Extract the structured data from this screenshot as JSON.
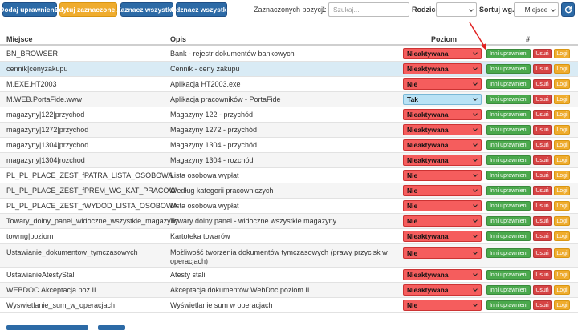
{
  "toolbar": {
    "add_label": "Dodaj uprawnienia",
    "bulk_label": "Edytuj zaznaczone",
    "select_all_label": "Zaznacz wszystkie",
    "deselect_all_label": "Odznacz wszystkie",
    "selected_count_label": "Zaznaczonych pozycji:",
    "selected_count_value": "1",
    "search_placeholder": "Szukaj...",
    "type_label": "Rodzic:",
    "type_value": "",
    "sort_label": "Sortuj wg.:",
    "sort_value": "Miejsce"
  },
  "table": {
    "columns": {
      "place": "Miejsce",
      "desc": "Opis",
      "level": "Poziom",
      "actions": "#"
    },
    "action_labels": {
      "other": "Inni uprawnieni",
      "delete": "Usuń",
      "logs": "Logi"
    },
    "rows": [
      {
        "place": "BN_BROWSER",
        "desc": "Bank - rejestr dokumentów bankowych",
        "level": "Nieaktywana",
        "level_color": "red"
      },
      {
        "place": "cennik|cenyzakupu",
        "desc": "Cennik - ceny zakupu",
        "level": "Nieaktywana",
        "level_color": "red"
      },
      {
        "place": "M.EXE.HT2003",
        "desc": "Aplikacja HT2003.exe",
        "level": "Nie",
        "level_color": "red"
      },
      {
        "place": "M.WEB.PortaFide.www",
        "desc": "Aplikacja pracowników - PortaFide",
        "level": "Tak",
        "level_color": "blue"
      },
      {
        "place": "magazyny|122|przychod",
        "desc": "Magazyny 122 - przychód",
        "level": "Nieaktywana",
        "level_color": "red"
      },
      {
        "place": "magazyny|1272|przychod",
        "desc": "Magazyny 1272 - przychód",
        "level": "Nieaktywana",
        "level_color": "red"
      },
      {
        "place": "magazyny|1304|przychod",
        "desc": "Magazyny 1304 - przychód",
        "level": "Nieaktywana",
        "level_color": "red"
      },
      {
        "place": "magazyny|1304|rozchod",
        "desc": "Magazyny 1304 - rozchód",
        "level": "Nieaktywana",
        "level_color": "red"
      },
      {
        "place": "PL_PL_PLACE_ZEST_fPATRA_LISTA_OSOBOWA",
        "desc": "Lista osobowa wypłat",
        "level": "Nie",
        "level_color": "red"
      },
      {
        "place": "PL_PL_PLACE_ZEST_fPREM_WG_KAT_PRACOW",
        "desc": "Według kategorii pracowniczych",
        "level": "Nie",
        "level_color": "red"
      },
      {
        "place": "PL_PL_PLACE_ZEST_fWYDOD_LISTA_OSOBOWA",
        "desc": "Lista osobowa wypłat",
        "level": "Nie",
        "level_color": "red"
      },
      {
        "place": "Towary_dolny_panel_widoczne_wszystkie_magazyny",
        "desc": "Towary dolny panel - widoczne wszystkie magazyny",
        "level": "Nie",
        "level_color": "red"
      },
      {
        "place": "towrng|poziom",
        "desc": "Kartoteka towarów",
        "level": "Nieaktywana",
        "level_color": "red"
      },
      {
        "place": "Ustawianie_dokumentow_tymczasowych",
        "desc": "Możliwość tworzenia dokumentów tymczasowych (prawy przycisk w operacjach)",
        "level": "Nie",
        "level_color": "red"
      },
      {
        "place": "UstawianieAtestyStali",
        "desc": "Atesty stali",
        "level": "Nieaktywana",
        "level_color": "red"
      },
      {
        "place": "WEBDOC.Akceptacja.poz.II",
        "desc": "Akceptacja dokumentów WebDoc poziom II",
        "level": "Nieaktywana",
        "level_color": "red"
      },
      {
        "place": "Wyswietlanie_sum_w_operacjach",
        "desc": "Wyświetlanie sum w operacjach",
        "level": "Nie",
        "level_color": "red"
      }
    ]
  }
}
